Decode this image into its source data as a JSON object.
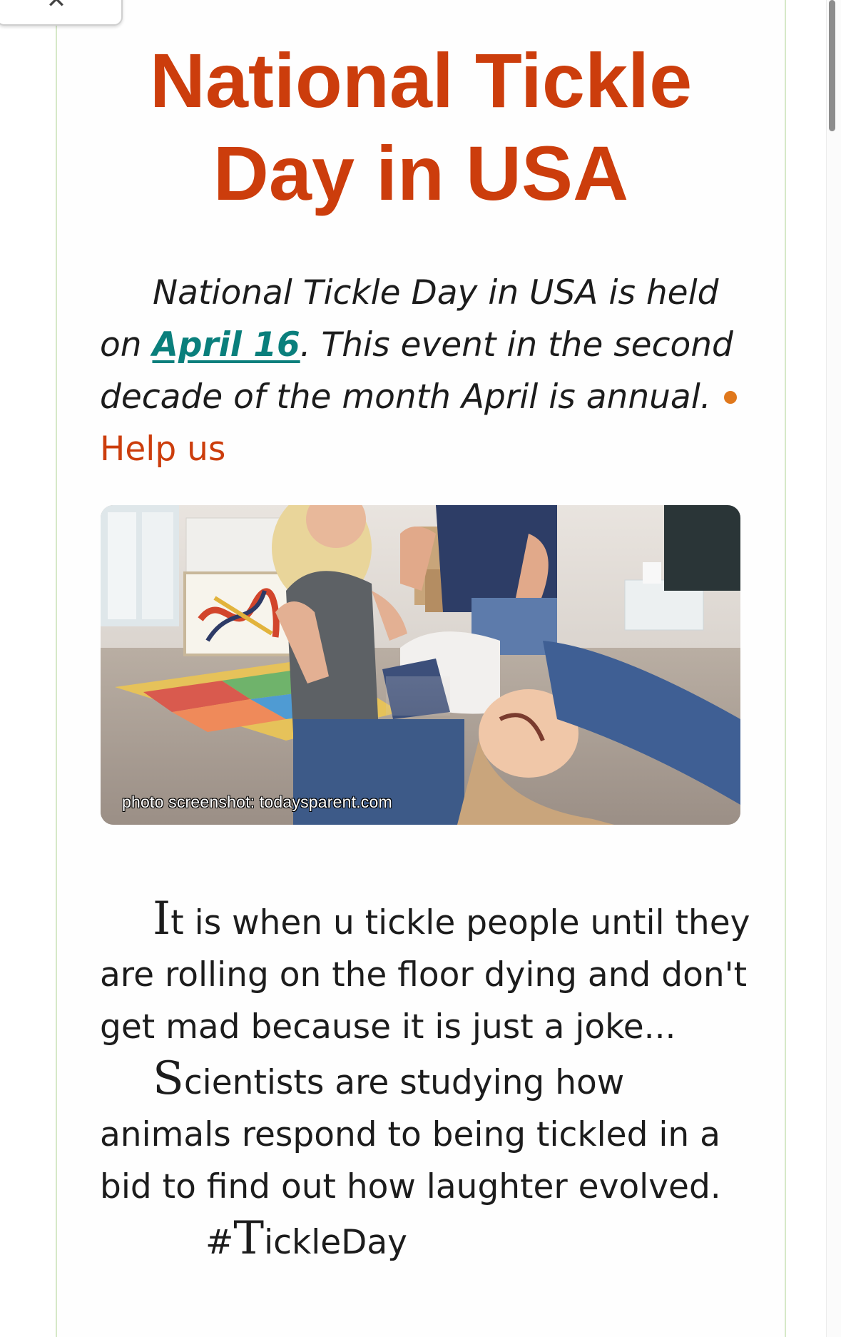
{
  "page": {
    "title": "National Tickle Day in USA",
    "intro": {
      "before_link": "National Tickle Day in USA is held on ",
      "date_link": "April 16",
      "after_link": ". This event in the second decade of the month April is annual.",
      "help_link": "Help us"
    },
    "photo": {
      "caption": "photo screenshot: todaysparent.com",
      "icon": "photo-of-family-tickling-child"
    },
    "paragraphs": [
      {
        "dropcap": "I",
        "text": "t is when u tickle people until they are rolling on the floor dying and don't get mad because it is just a joke..."
      },
      {
        "dropcap": "S",
        "text": "cientists are studying how animals respond to being tickled in a bid to find out how laughter evolved."
      }
    ],
    "hashtag": {
      "dropcap": "T",
      "prefix": "#",
      "text": "ickleDay"
    }
  },
  "colors": {
    "title": "#cc3d0c",
    "link": "#0a7f7c",
    "bullet": "#e0781c",
    "column_border": "#d6e8c8"
  }
}
